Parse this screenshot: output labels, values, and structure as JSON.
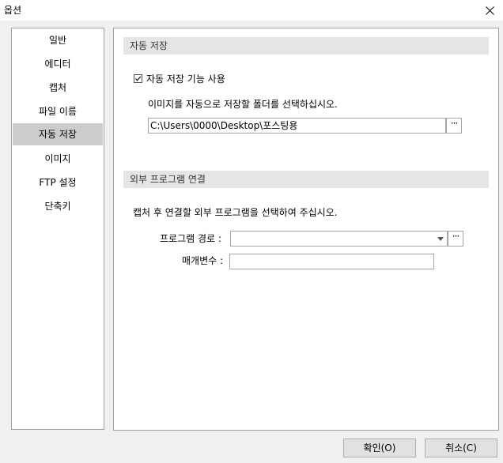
{
  "window": {
    "title": "옵션"
  },
  "sidebar": {
    "items": [
      {
        "label": "일반"
      },
      {
        "label": "에디터"
      },
      {
        "label": "캡처"
      },
      {
        "label": "파일 이름"
      },
      {
        "label": "자동 저장",
        "selected": true
      },
      {
        "label": "이미지"
      },
      {
        "label": "FTP 설정"
      },
      {
        "label": "단축키"
      }
    ]
  },
  "autosave": {
    "header": "자동 저장",
    "enable_label": "자동 저장 기능 사용",
    "enable_checked": true,
    "folder_instruction": "이미지를 자동으로 저장할 폴더를 선택하십시오.",
    "folder_path": "C:\\Users\\0000\\Desktop\\포스팅용",
    "browse_label": "···"
  },
  "external": {
    "header": "외부 프로그램 연결",
    "instruction": "캡처 후 연결할 외부 프로그램을 선택하여 주십시오.",
    "program_path_label": "프로그램 경로 :",
    "program_path_value": "",
    "browse_label": "···",
    "params_label": "매개변수 :",
    "params_value": ""
  },
  "footer": {
    "ok_label": "확인(O)",
    "cancel_label": "취소(C)"
  },
  "icons": {
    "close": "close-icon",
    "check": "check-icon",
    "dropdown": "chevron-down-icon"
  }
}
